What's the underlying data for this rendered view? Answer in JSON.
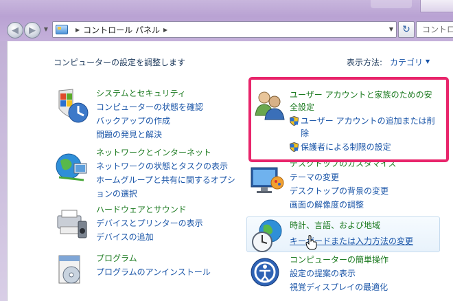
{
  "address_bar": {
    "path": [
      "コントロール パネル"
    ],
    "search_placeholder": "コントロ"
  },
  "header": {
    "title": "コンピューターの設定を調整します",
    "view_label": "表示方法:",
    "view_value": "カテゴリ"
  },
  "categories": {
    "system": {
      "title": "システムとセキュリティ",
      "links": [
        "コンピューターの状態を確認",
        "バックアップの作成",
        "問題の発見と解決"
      ]
    },
    "network": {
      "title": "ネットワークとインターネット",
      "links": [
        "ネットワークの状態とタスクの表示",
        "ホームグループと共有に関するオプシ",
        "ョンの選択"
      ]
    },
    "hardware": {
      "title": "ハードウェアとサウンド",
      "links": [
        "デバイスとプリンターの表示",
        "デバイスの追加"
      ]
    },
    "programs": {
      "title": "プログラム",
      "links": [
        "プログラムのアンインストール"
      ]
    },
    "user_accounts": {
      "title_line1": "ユーザー アカウントと家族のための安",
      "title_line2": "全設定",
      "links": [
        "ユーザー アカウントの追加または削",
        "除",
        "保護者による制限の設定"
      ]
    },
    "appearance": {
      "title": "デスクトップのカスタマイズ",
      "links": [
        "テーマの変更",
        "デスクトップの背景の変更",
        "画面の解像度の調整"
      ]
    },
    "clock": {
      "title": "時計、言語、および地域",
      "links": [
        "キーボードまたは入力方法の変更"
      ]
    },
    "ease": {
      "title": "コンピューターの簡単操作",
      "links": [
        "設定の提案の表示",
        "視覚ディスプレイの最適化"
      ]
    }
  },
  "colors": {
    "category_title": "#1b7a1f",
    "link": "#1a55a8",
    "highlight": "#e8256b"
  }
}
